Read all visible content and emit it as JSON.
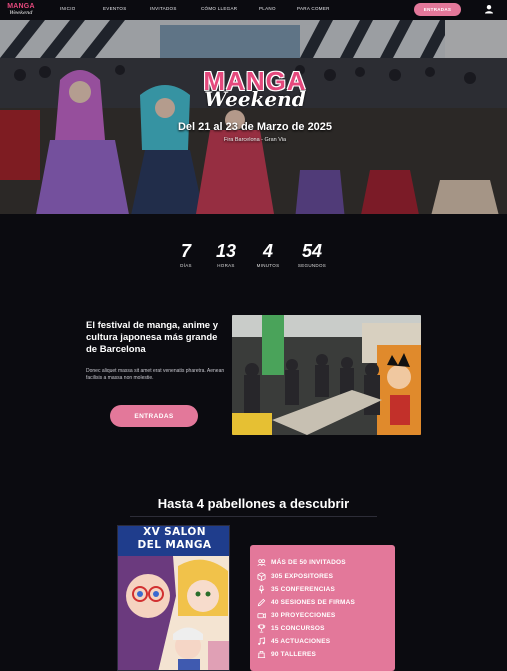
{
  "nav": {
    "logo_line1": "MANGA",
    "logo_line2": "Weekend",
    "items": [
      "INICIO",
      "EVENTOS",
      "INVITADOS",
      "CÓMO LLEGAR",
      "PLANO",
      "PARA COMER"
    ],
    "cta": "ENTRADAS",
    "user_icon": "user-icon"
  },
  "hero": {
    "logo_line1": "MANGA",
    "logo_line2": "Weekend",
    "date": "Del 21 al 23 de Marzo de 2025",
    "venue": "Fira Barcelona - Gran Via"
  },
  "countdown": [
    {
      "value": "7",
      "label": "DÍAS"
    },
    {
      "value": "13",
      "label": "HORAS"
    },
    {
      "value": "4",
      "label": "MINUTOS"
    },
    {
      "value": "54",
      "label": "SEGUNDOS"
    }
  ],
  "feature": {
    "title": "El festival de manga, anime y cultura japonesa más grande de Barcelona",
    "text": "Donec aliquet massa sit amet erat venenatis pharetra. Aenean facilisis a massa non molestie.",
    "cta": "ENTRADAS"
  },
  "pavilions": {
    "title": "Hasta 4 pabellones a descubrir",
    "poster_line1": "XV SALÓN",
    "poster_line2": "DEL MANGA",
    "items": [
      {
        "icon": "guests-icon",
        "label": "MÁS DE 50 INVITADOS"
      },
      {
        "icon": "box-icon",
        "label": "305 EXPOSITORES"
      },
      {
        "icon": "microphone-icon",
        "label": "35 CONFERENCIAS"
      },
      {
        "icon": "pen-icon",
        "label": "40 SESIONES DE FIRMAS"
      },
      {
        "icon": "projector-icon",
        "label": "30 PROYECCIONES"
      },
      {
        "icon": "trophy-icon",
        "label": "15 CONCURSOS"
      },
      {
        "icon": "music-icon",
        "label": "45 ACTUACIONES"
      },
      {
        "icon": "workshop-icon",
        "label": "90 TALLERES"
      }
    ]
  },
  "colors": {
    "accent": "#e3789a",
    "logo_pink": "#e5497d",
    "background": "#0b0b10"
  }
}
